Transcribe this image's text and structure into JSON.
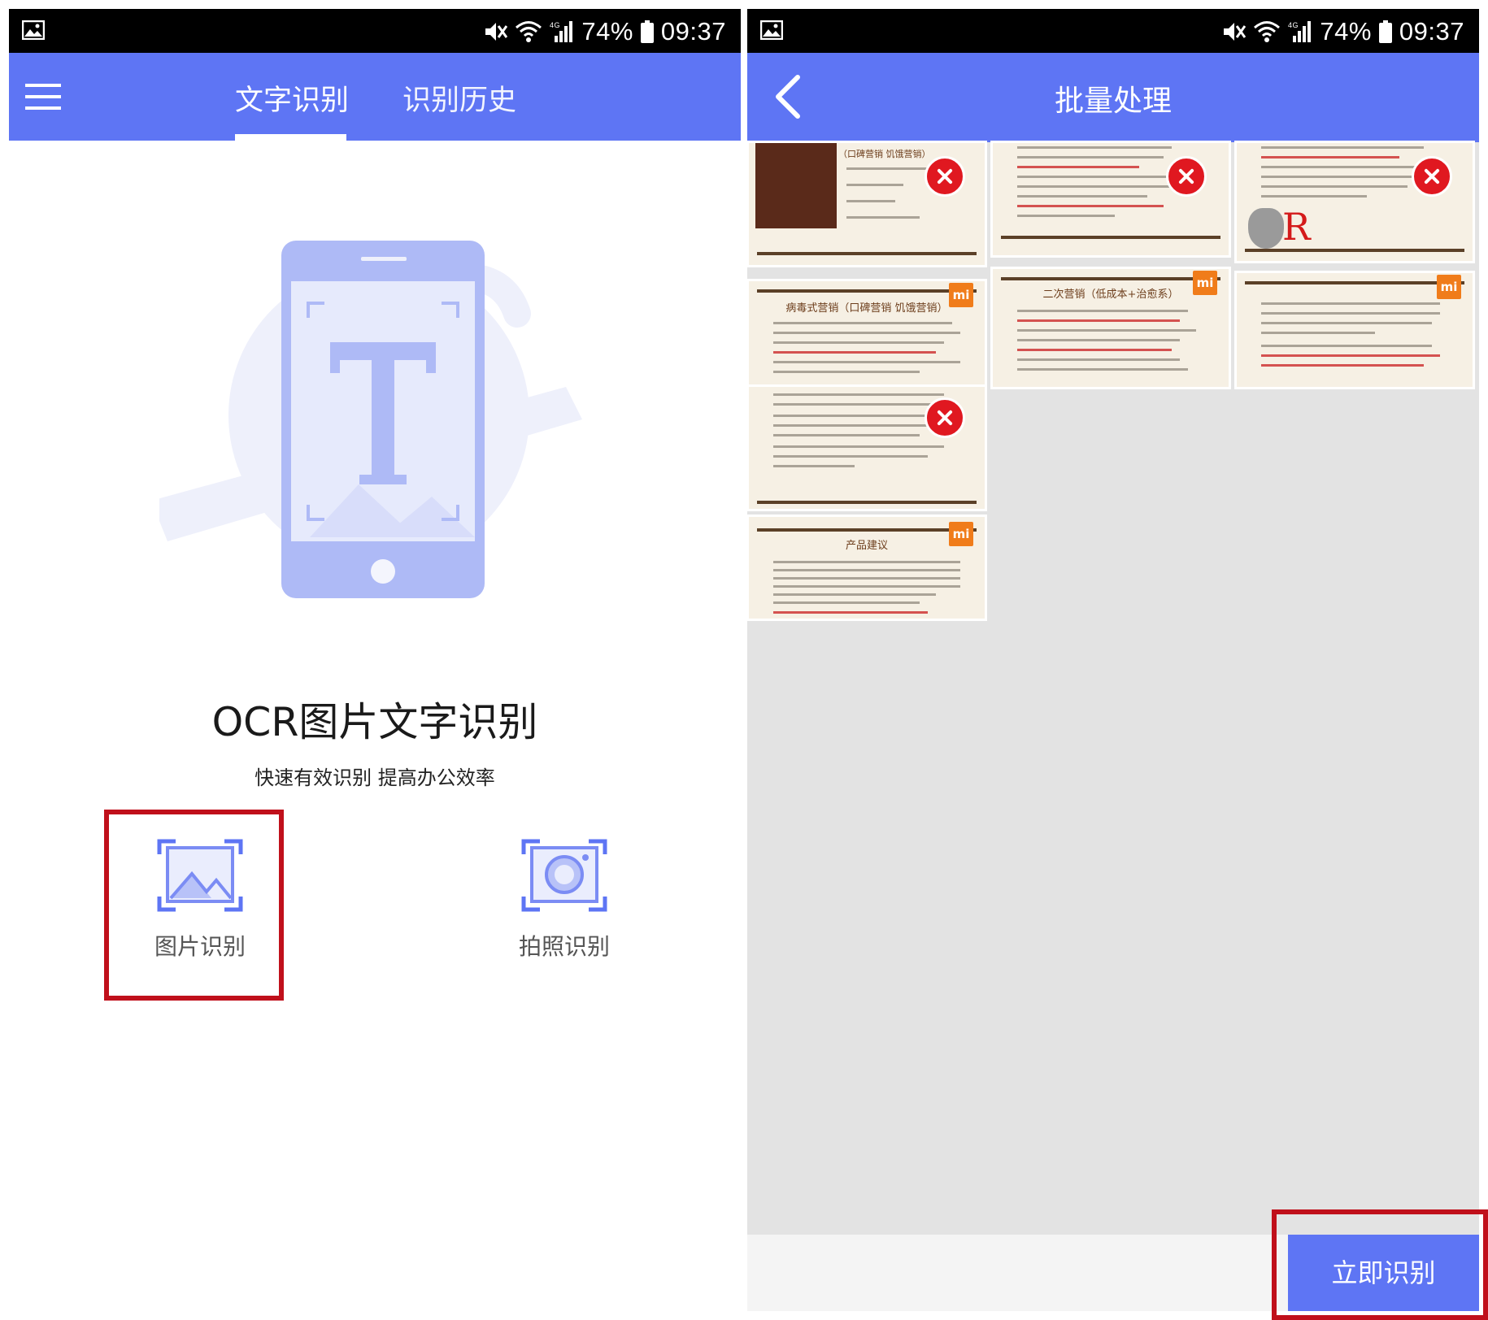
{
  "status": {
    "battery": "74%",
    "time": "09:37"
  },
  "left_screen": {
    "tabs": [
      {
        "label": "文字识别",
        "active": true
      },
      {
        "label": "识别历史",
        "active": false
      }
    ],
    "title": "OCR图片文字识别",
    "subtitle": "快速有效识别  提高办公效率",
    "actions": {
      "image_label": "图片识别",
      "photo_label": "拍照识别"
    }
  },
  "right_screen": {
    "title": "批量处理",
    "thumbnails": [
      {
        "title": "（口碑营销 饥饿营销）",
        "removable": true
      },
      {
        "title": "",
        "removable": true
      },
      {
        "title": "",
        "removable": true
      },
      {
        "title": "病毒式营销（口碑营销 饥饿营销）",
        "removable": false
      },
      {
        "title": "二次营销（低成本+治愈系）",
        "removable": false
      },
      {
        "title": "",
        "removable": false
      },
      {
        "title": "",
        "removable": true
      },
      {
        "title": "产品建议",
        "removable": false
      }
    ],
    "recognize_button": "立即识别"
  },
  "colors": {
    "primary": "#5e75f4",
    "highlight": "#c0101b",
    "delete": "#e01820",
    "mi_logo": "#f07c1a"
  }
}
